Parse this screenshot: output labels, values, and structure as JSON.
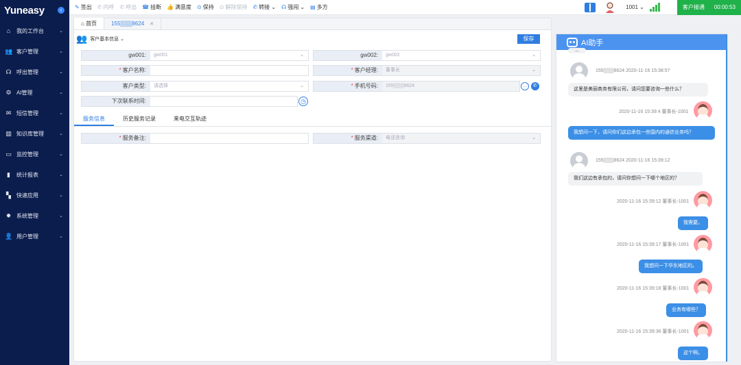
{
  "sidebar": {
    "brand": "Yuneasy",
    "items": [
      {
        "label": "我的工作台",
        "icon": "home-icon"
      },
      {
        "label": "客户管理",
        "icon": "users-icon"
      },
      {
        "label": "呼出管理",
        "icon": "headset-icon"
      },
      {
        "label": "AI管理",
        "icon": "ai-gear-icon"
      },
      {
        "label": "短信管理",
        "icon": "mail-icon"
      },
      {
        "label": "知识库管理",
        "icon": "book-icon"
      },
      {
        "label": "监控管理",
        "icon": "camera-icon"
      },
      {
        "label": "统计报表",
        "icon": "bar-chart-icon"
      },
      {
        "label": "快速应用",
        "icon": "apps-icon"
      },
      {
        "label": "系统管理",
        "icon": "gear-icon"
      },
      {
        "label": "用户管理",
        "icon": "user-icon"
      }
    ]
  },
  "toolbar": {
    "items": [
      {
        "label": "签出",
        "icon": "signout-icon",
        "disabled": false
      },
      {
        "label": "内呼",
        "icon": "phone-icon",
        "disabled": true
      },
      {
        "label": "呼出",
        "icon": "phone-out-icon",
        "disabled": true
      },
      {
        "label": "挂断",
        "icon": "hangup-icon",
        "disabled": false
      },
      {
        "label": "满意度",
        "icon": "thumb-icon",
        "disabled": false
      },
      {
        "label": "保持",
        "icon": "hold-icon",
        "disabled": false
      },
      {
        "label": "解除保持",
        "icon": "resume-icon",
        "disabled": true
      },
      {
        "label": "转接",
        "icon": "transfer-icon",
        "disabled": false,
        "dropdown": true
      },
      {
        "label": "强闯",
        "icon": "headset-icon",
        "disabled": false,
        "dropdown": true
      },
      {
        "label": "多方",
        "icon": "conference-icon",
        "disabled": false
      }
    ],
    "extension": "1001",
    "status_label": "客户接通",
    "timer": "00:00:53"
  },
  "tabs": {
    "home": "首页",
    "phone": "155▒▒▒8624"
  },
  "info": {
    "title": "客户基本信息",
    "save": "保存"
  },
  "form": {
    "gw001_label": "gw001:",
    "gw001_value": "gw001",
    "gw002_label": "gw002:",
    "gw002_value": "gw002",
    "name_label": "客户名称:",
    "manager_label": "客户经理:",
    "manager_value": "董事长",
    "type_label": "客户类型:",
    "type_value": "请选择",
    "phone_label": "手机号码:",
    "phone_value": "155▒▒▒8624",
    "next_contact_label": "下次联系时间:",
    "remark_label": "服务备注:",
    "channel_label": "服务渠道:",
    "channel_value": "电话咨询"
  },
  "subtabs": [
    "服务信息",
    "历史服务记录",
    "来电交互轨迹"
  ],
  "ai": {
    "title": "AI助手",
    "top_cut": "...",
    "messages": [
      {
        "side": "left",
        "meta": "155▒▒▒8624  2020-11-16 15:38:57",
        "text": "这里是美丽商务有限公司，请问您要咨询一些什么？"
      },
      {
        "side": "right",
        "meta": "2020-11-16 15:39:4  董事长-1001",
        "text": "我想问一下，请问你们这边承包一些国内的通信业务吗？"
      },
      {
        "side": "left",
        "meta": "155▒▒▒8624  2020-11-16 15:39:12",
        "text": "我们这边有承包的，请问你想问一下哪个地区的？"
      },
      {
        "side": "right",
        "meta": "2020-11-16 15:39:12  董事长-1001",
        "text": "我需要。"
      },
      {
        "side": "right",
        "meta": "2020-11-16 15:39:17  董事长-1001",
        "text": "我想问一下华东地区的。"
      },
      {
        "side": "right",
        "meta": "2020-11-16 15:39:18  董事长-1001",
        "text": "业务有哪些？"
      },
      {
        "side": "right",
        "meta": "2020-11-16 15:39:36  董事长-1001",
        "text": "这个啊。"
      }
    ]
  }
}
